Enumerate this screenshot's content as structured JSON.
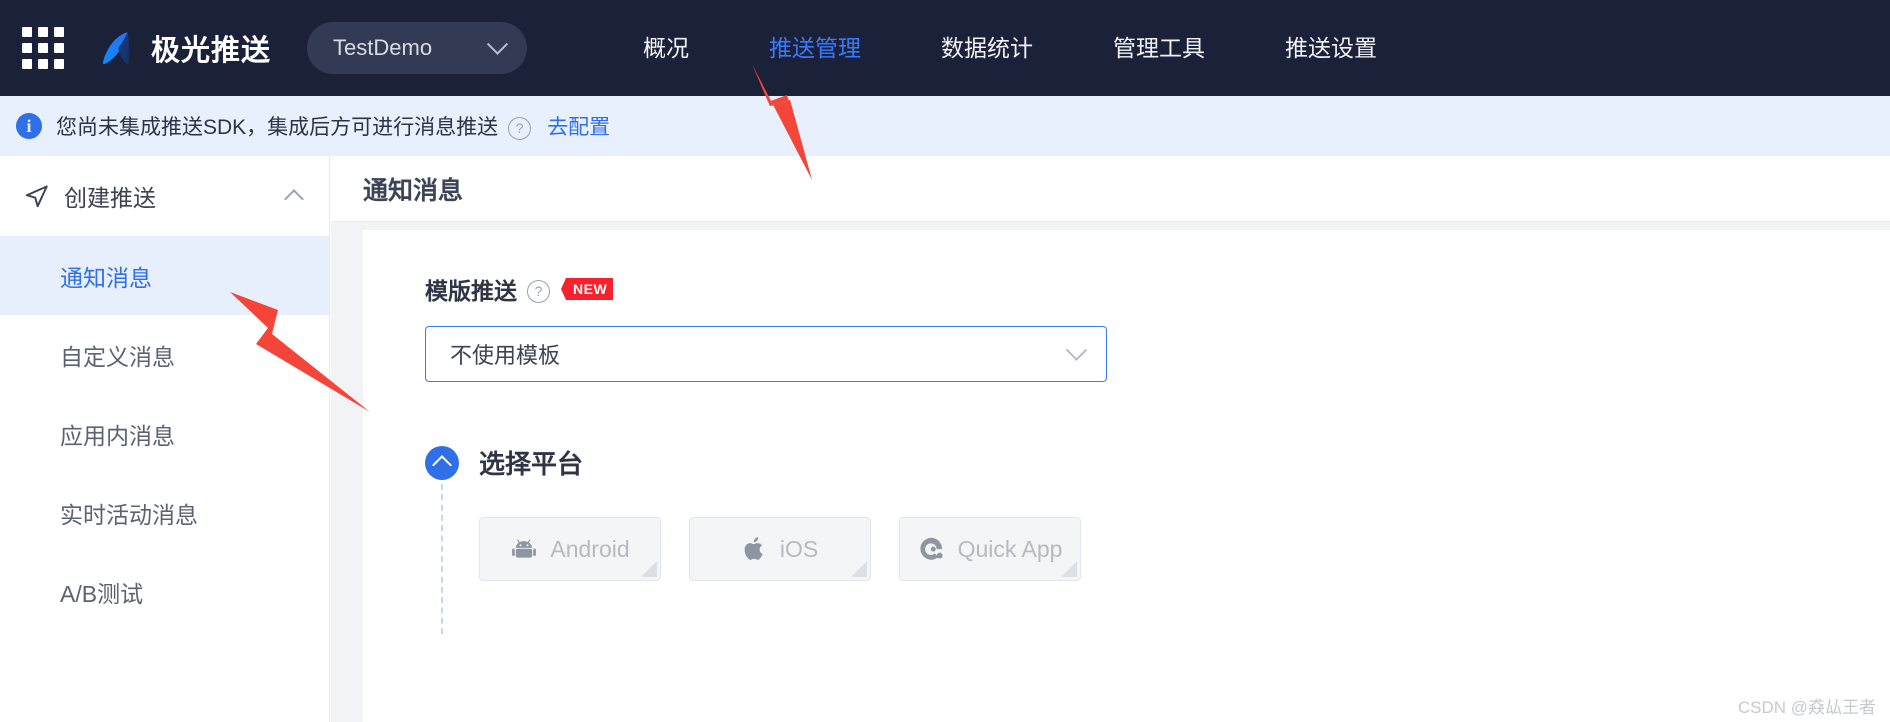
{
  "topbar": {
    "grid_icon": "apps-grid-icon",
    "brand_logo_icon": "jiguang-logo-icon",
    "brand_name": "极光推送",
    "app_switcher": {
      "current_app": "TestDemo",
      "chevron_icon": "chevron-down-icon"
    },
    "nav": [
      {
        "label": "概况",
        "active": false
      },
      {
        "label": "推送管理",
        "active": true
      },
      {
        "label": "数据统计",
        "active": false
      },
      {
        "label": "管理工具",
        "active": false
      },
      {
        "label": "推送设置",
        "active": false
      }
    ]
  },
  "notice": {
    "icon": "info-circle-icon",
    "text": "您尚未集成推送SDK，集成后方可进行消息推送",
    "help_icon": "question-circle-icon",
    "link_label": "去配置"
  },
  "sidebar": {
    "group": {
      "icon": "paper-plane-icon",
      "label": "创建推送",
      "collapse_icon": "chevron-up-icon",
      "expanded": true
    },
    "items": [
      {
        "label": "通知消息",
        "active": true
      },
      {
        "label": "自定义消息",
        "active": false
      },
      {
        "label": "应用内消息",
        "active": false
      },
      {
        "label": "实时活动消息",
        "active": false
      },
      {
        "label": "A/B测试",
        "active": false
      }
    ]
  },
  "main": {
    "page_title": "通知消息",
    "template_field": {
      "label": "模版推送",
      "help_icon": "question-circle-icon",
      "badge": "NEW",
      "select_value": "不使用模板",
      "select_caret_icon": "chevron-down-icon"
    },
    "platform_section": {
      "toggle_icon": "chevron-up-circle-icon",
      "title": "选择平台",
      "platforms": [
        {
          "label": "Android",
          "icon": "android-icon"
        },
        {
          "label": "iOS",
          "icon": "apple-icon"
        },
        {
          "label": "Quick App",
          "icon": "quickapp-icon"
        }
      ]
    }
  },
  "colors": {
    "nav_bg": "#1b2138",
    "accent": "#2f6fe8",
    "active_link": "#3a7afe",
    "notice_bg": "#e8f0fe",
    "badge_red": "#f5222d",
    "annotation_arrow": "#f4453a"
  },
  "watermark": "CSDN @猋厸王者"
}
